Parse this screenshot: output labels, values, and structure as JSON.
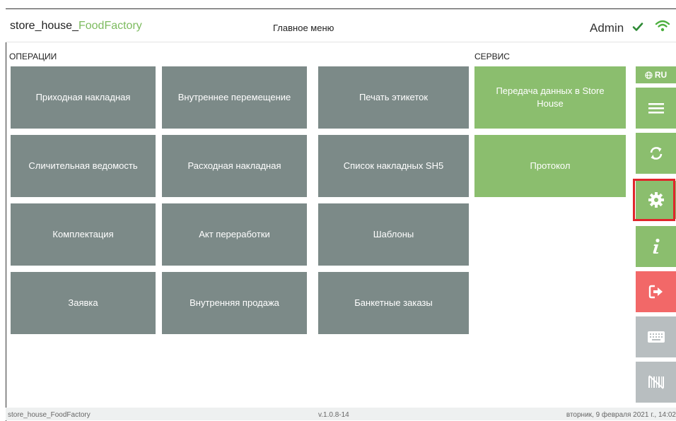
{
  "header": {
    "app_name_main": "store_house_",
    "app_name_accent": "FoodFactory",
    "title": "Главное меню",
    "user": "Admin"
  },
  "sections": {
    "operations": "ОПЕРАЦИИ",
    "service": "СЕРВИС"
  },
  "operations": [
    "Приходная накладная",
    "Внутреннее перемещение",
    "Печать этикеток",
    "Сличительная ведомость",
    "Расходная накладная",
    "Список накладных SH5",
    "Комплектация",
    "Акт переработки",
    "Шаблоны",
    "Заявка",
    "Внутренняя продажа",
    "Банкетные заказы"
  ],
  "service": [
    "Передача данных в Store House",
    "Протокол"
  ],
  "sidebar": {
    "language": "RU",
    "icons": [
      "menu-icon",
      "sync-icon",
      "settings-icon",
      "info-icon",
      "logout-icon",
      "keyboard-icon",
      "barcode-icon"
    ]
  },
  "footer": {
    "app": "store_house_FoodFactory",
    "version": "v.1.0.8-14",
    "datetime": "вторник, 9 февраля 2021 г., 14:02"
  },
  "colors": {
    "tile_gray": "#7c8a88",
    "tile_green": "#8bbe6e",
    "danger": "#f26868",
    "disabled": "#b8bec0",
    "highlight": "#e0252b"
  }
}
